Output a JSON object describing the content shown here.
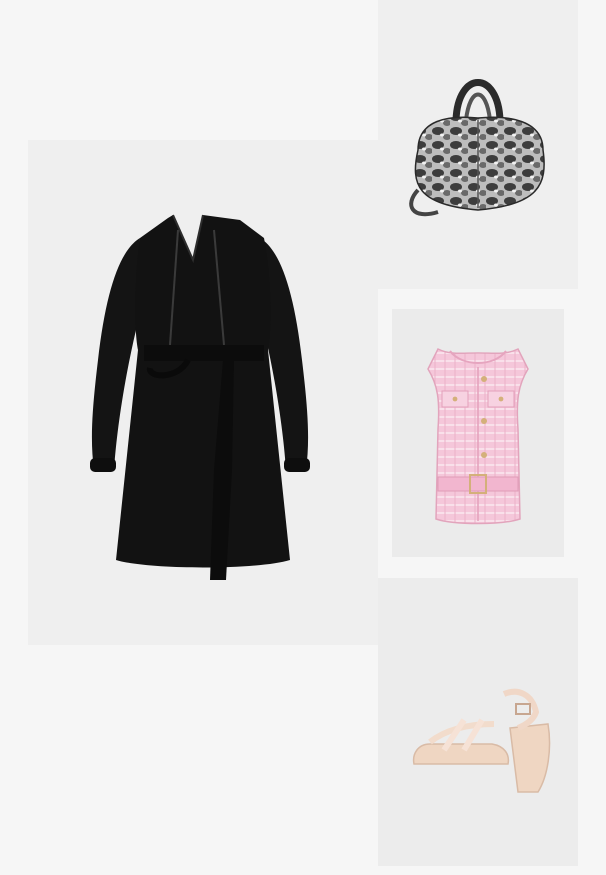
{
  "outfit": {
    "items": [
      {
        "category": "dress",
        "color": "#121212",
        "image_name": "black-belted-dress-image"
      },
      {
        "category": "bag",
        "color": "#8a8a8a",
        "image_name": "snakeskin-bag-image"
      },
      {
        "category": "vest",
        "color": "#f3bcd3",
        "image_name": "pink-tweed-vest-image"
      },
      {
        "category": "sandal",
        "color": "#efd9c8",
        "image_name": "nude-platform-sandal-image"
      }
    ],
    "background_color": "#f6f6f6",
    "tile_color": "#efefef"
  }
}
